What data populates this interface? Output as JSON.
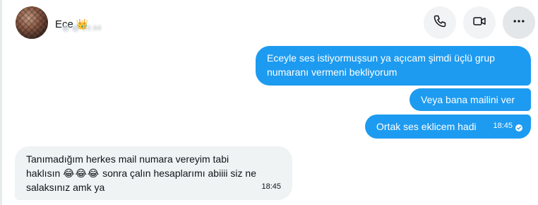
{
  "header": {
    "contact_name": "Ece",
    "crown_glyph": "👑",
    "status_blurred": "14:44",
    "buttons": [
      {
        "name": "call-button",
        "icon": "phone-icon"
      },
      {
        "name": "video-button",
        "icon": "video-icon"
      },
      {
        "name": "more-button",
        "icon": "more-horizontal-icon"
      }
    ]
  },
  "messages": [
    {
      "direction": "outgoing",
      "text_line1": "Eceyle ses istiyormuşsun ya açıcam şimdi üçlü grup",
      "text_line2": "numaranı vermeni bekliyorum"
    },
    {
      "direction": "outgoing",
      "text": "Veya bana mailini ver"
    },
    {
      "direction": "outgoing",
      "text": "Ortak ses eklicem hadi",
      "time": "18:45",
      "read_indicator": "check-icon"
    },
    {
      "direction": "incoming",
      "text_line1": "Tanımadığım herkes mail numara vereyim tabi",
      "text_line2_start": "haklısın",
      "emojis": "😂😂😂",
      "text_line2_end": "sonra çalın hesaplarımı abiiii siz ne",
      "text_line3": "salaksınız amk ya",
      "time": "18:45"
    }
  ],
  "colors": {
    "outgoing_bubble": "#1d9bf0",
    "incoming_bubble": "#eff3f4",
    "header_button_bg": "#f1f3f5"
  }
}
